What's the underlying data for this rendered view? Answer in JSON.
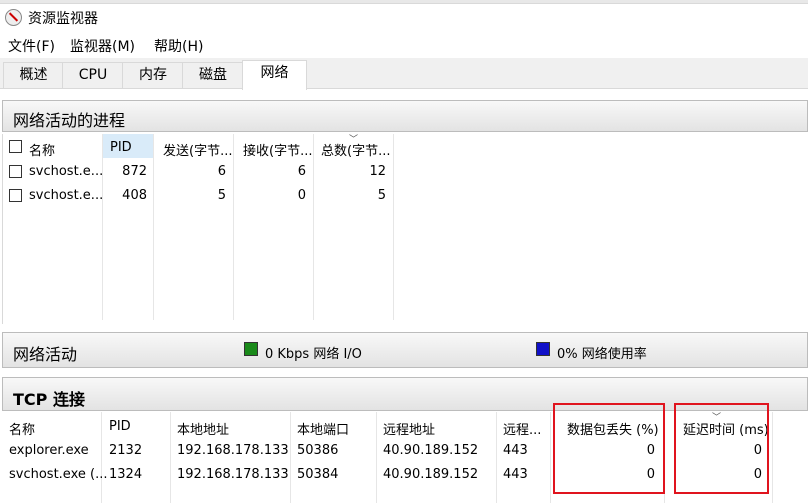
{
  "window": {
    "title": "资源监视器"
  },
  "menu": [
    "文件(F)",
    "监视器(M)",
    "帮助(H)"
  ],
  "tabs": [
    "概述",
    "CPU",
    "内存",
    "磁盘",
    "网络"
  ],
  "active_tab": "网络",
  "processes": {
    "title": "网络活动的进程",
    "columns": [
      "名称",
      "PID",
      "发送(字节...",
      "接收(字节...",
      "总数(字节..."
    ],
    "rows": [
      {
        "name": "svchost.e...",
        "pid": "872",
        "sent": "6",
        "recv": "6",
        "total": "12"
      },
      {
        "name": "svchost.e...",
        "pid": "408",
        "sent": "5",
        "recv": "0",
        "total": "5"
      }
    ]
  },
  "network_activity": {
    "title": "网络活动",
    "io": "0 Kbps 网络 I/O",
    "usage": "0% 网络使用率",
    "io_color": "#1a8a1a",
    "usage_color": "#1010c8"
  },
  "tcp": {
    "title": "TCP 连接",
    "columns": [
      "名称",
      "PID",
      "本地地址",
      "本地端口",
      "远程地址",
      "远程...",
      "数据包丢失 (%)",
      "延迟时间 (ms)"
    ],
    "rows": [
      {
        "name": "explorer.exe",
        "pid": "2132",
        "local_addr": "192.168.178.133",
        "local_port": "50386",
        "remote_addr": "40.90.189.152",
        "remote_port": "443",
        "loss": "0",
        "latency": "0"
      },
      {
        "name": "svchost.exe (...",
        "pid": "1324",
        "local_addr": "192.168.178.133",
        "local_port": "50384",
        "remote_addr": "40.90.189.152",
        "remote_port": "443",
        "loss": "0",
        "latency": "0"
      }
    ]
  },
  "highlight_color": "#e0141e"
}
